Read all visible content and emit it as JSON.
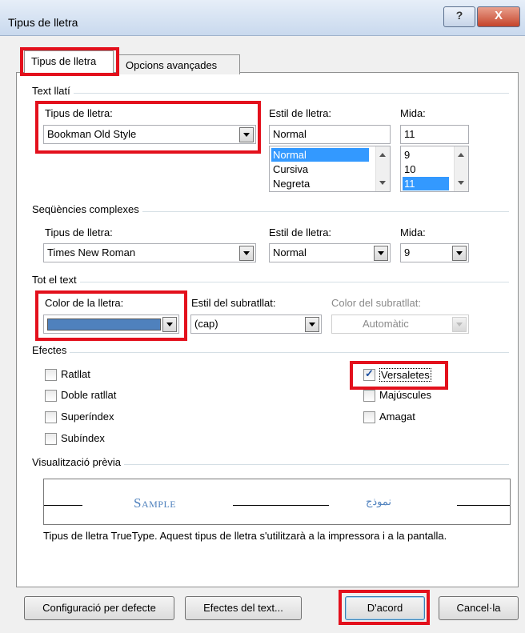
{
  "window": {
    "title": "Tipus de lletra",
    "help_glyph": "?",
    "close_glyph": "X"
  },
  "tabs": [
    {
      "label": "Tipus de lletra"
    },
    {
      "label": "Opcions avançades"
    }
  ],
  "text_lati": {
    "heading": "Text llatí",
    "font_label": "Tipus de lletra:",
    "font_value": "Bookman Old Style",
    "style_label": "Estil de lletra:",
    "style_value": "Normal",
    "style_options": [
      "Normal",
      "Cursiva",
      "Negreta"
    ],
    "size_label": "Mida:",
    "size_value": "11",
    "size_options": [
      "9",
      "10",
      "11"
    ]
  },
  "complex": {
    "heading": "Seqüències complexes",
    "font_label": "Tipus de lletra:",
    "font_value": "Times New Roman",
    "style_label": "Estil de lletra:",
    "style_value": "Normal",
    "size_label": "Mida:",
    "size_value": "9"
  },
  "all_text": {
    "heading": "Tot el text",
    "color_label": "Color de la lletra:",
    "color_value": "#4f81bd",
    "underline_label": "Estil del subratllat:",
    "underline_value": "(cap)",
    "underline_color_label": "Color del subratllat:",
    "underline_color_value": "Automàtic"
  },
  "effects": {
    "heading": "Efectes",
    "items": [
      {
        "label": "Ratllat",
        "checked": false
      },
      {
        "label": "Doble ratllat",
        "checked": false
      },
      {
        "label": "Superíndex",
        "checked": false
      },
      {
        "label": "Subíndex",
        "checked": false
      },
      {
        "label": "Versaletes",
        "checked": true
      },
      {
        "label": "Majúscules",
        "checked": false
      },
      {
        "label": "Amagat",
        "checked": false
      }
    ]
  },
  "preview": {
    "heading": "Visualització prèvia",
    "latin_sample": "Sample",
    "arabic_sample": "نموذج",
    "note": "Tipus de lletra TrueType. Aquest tipus de lletra s'utilitzarà a la impressora i a la pantalla.",
    "sample_color": "#4f81bd"
  },
  "buttons": {
    "defaults": "Configuració per defecte",
    "text_effects": "Efectes del text...",
    "ok": "D'acord",
    "cancel": "Cancel·la"
  },
  "highlight_color": "#e3101c"
}
